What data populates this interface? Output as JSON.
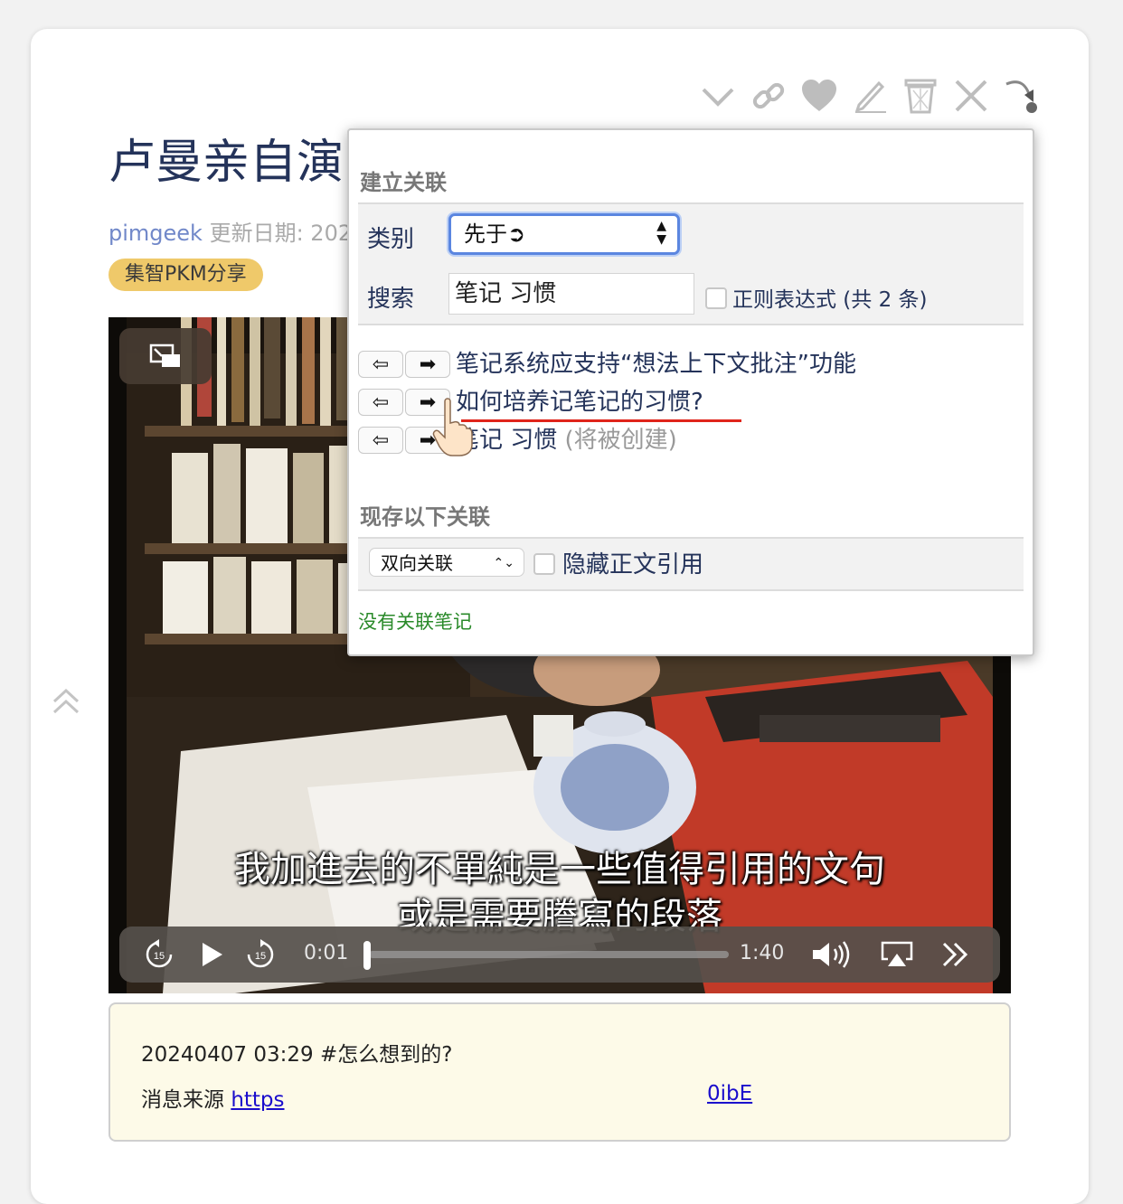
{
  "page": {
    "title": "卢曼亲自演",
    "author": "pimgeek",
    "updated": "更新日期: 202",
    "tag": "集智PKM分享"
  },
  "toolbar": {
    "icons": [
      "chevron-down-icon",
      "link-icon",
      "heart-icon",
      "pencil-icon",
      "trash-icon",
      "close-icon",
      "redirect-icon"
    ]
  },
  "video": {
    "subtitle_line1": "我加進去的不單純是一些值得引用的文句",
    "subtitle_line2": "或是需要謄寫的段落",
    "current_time": "0:01",
    "duration": "1:40",
    "progress": 0.01
  },
  "note": {
    "line1": "20240407 03:29 #怎么想到的?",
    "source_label": "消息来源",
    "link1": "https",
    "link2": "0ibE"
  },
  "popup": {
    "section1_title": "建立关联",
    "category_label": "类别",
    "category_value": "先于➲",
    "search_label": "搜索",
    "search_value": "笔记 习惯",
    "regex_label": "正则表达式 (共 2 条)",
    "results": [
      {
        "text": "笔记系统应支持“想法上下文批注”功能",
        "suffix": ""
      },
      {
        "text": "如何培养记笔记的习惯?",
        "suffix": ""
      },
      {
        "text": "笔记 习惯",
        "suffix": "(将被创建)"
      }
    ],
    "left_arrow": "⇦",
    "right_arrow": "➡",
    "section2_title": "现存以下关联",
    "relation_select": "双向关联",
    "hide_ref_label": "隐藏正文引用",
    "empty_text": "没有关联笔记"
  }
}
